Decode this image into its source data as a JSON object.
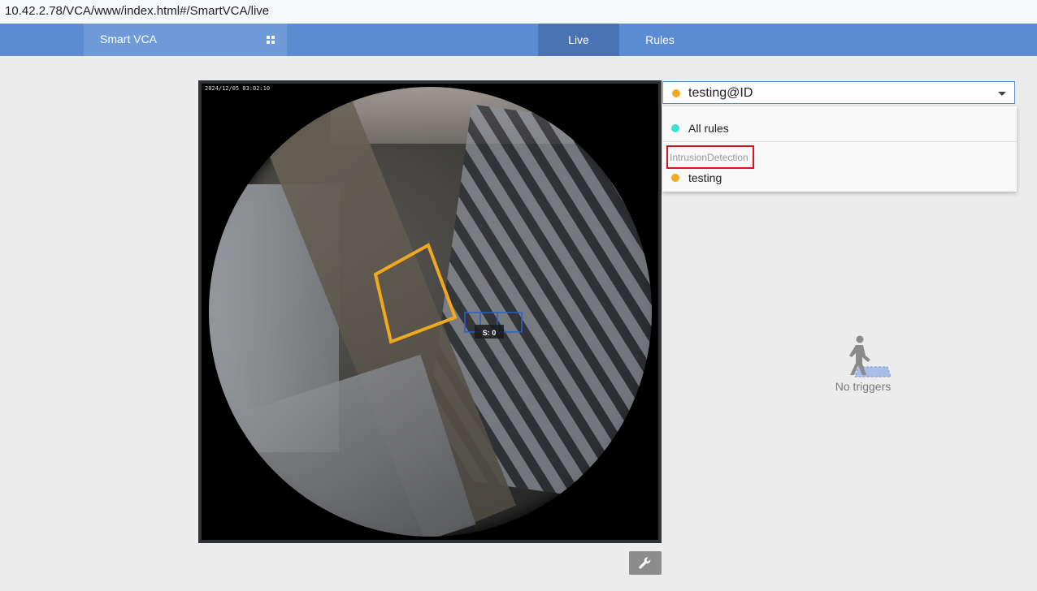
{
  "browser": {
    "url": "10.42.2.78/VCA/www/index.html#/SmartVCA/live"
  },
  "nav": {
    "brand": "Smart VCA",
    "brand_icon": "grid-icon",
    "tabs": [
      {
        "label": "Live",
        "active": true
      },
      {
        "label": "Rules",
        "active": false
      }
    ],
    "bar_color": "#5b8bd0",
    "active_color": "#4a73b3"
  },
  "video": {
    "timestamp": "2024/12/05 03:02:10",
    "zone_color": "#f0a81e",
    "counter_label": "S: 0",
    "counter_color": "#2a5fc8"
  },
  "rule_selector": {
    "selected": "testing@ID",
    "selected_dot_color": "#f0a81e",
    "options": {
      "all_rules": "All rules",
      "group_label": "IntrusionDetection",
      "testing": "testing"
    }
  },
  "triggers": {
    "empty_label": "No triggers",
    "icon": "walking-person-icon"
  },
  "tools": {
    "settings_icon": "wrench-icon"
  }
}
